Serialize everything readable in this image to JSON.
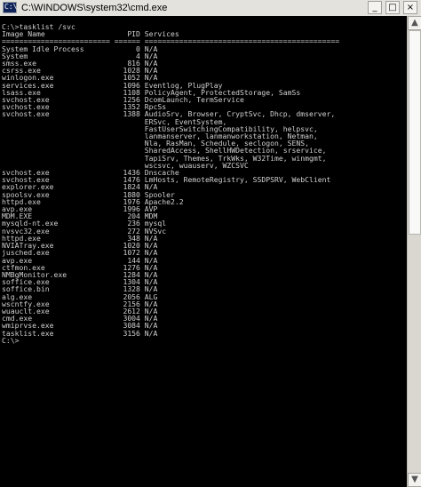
{
  "window": {
    "title": "C:\\WINDOWS\\system32\\cmd.exe",
    "icon_label": "C:\\",
    "buttons": {
      "minimize": "_",
      "maximize": "□",
      "close": "×"
    }
  },
  "scrollbar": {
    "up": "▲",
    "down": "▼"
  },
  "console": {
    "lines": [
      "C:\\>tasklist /svc",
      "",
      "Image Name                   PID Services",
      "========================= ====== =============================================",
      "System Idle Process            0 N/A",
      "System                         4 N/A",
      "smss.exe                     816 N/A",
      "csrss.exe                   1028 N/A",
      "winlogon.exe                1052 N/A",
      "services.exe                1096 Eventlog, PlugPlay",
      "lsass.exe                   1108 PolicyAgent, ProtectedStorage, SamSs",
      "svchost.exe                 1256 DcomLaunch, TermService",
      "svchost.exe                 1352 RpcSs",
      "svchost.exe                 1388 AudioSrv, Browser, CryptSvc, Dhcp, dmserver,",
      "                                 ERSvc, EventSystem,",
      "                                 FastUserSwitchingCompatibility, helpsvc,",
      "                                 lanmanserver, lanmanworkstation, Netman,",
      "                                 Nla, RasMan, Schedule, seclogon, SENS,",
      "                                 SharedAccess, ShellHWDetection, srservice,",
      "                                 TapiSrv, Themes, TrkWks, W32Time, winmgmt,",
      "                                 wscsvc, wuauserv, WZCSVC",
      "svchost.exe                 1436 Dnscache",
      "svchost.exe                 1476 LmHosts, RemoteRegistry, SSDPSRV, WebClient",
      "explorer.exe                1824 N/A",
      "spoolsv.exe                 1880 Spooler",
      "httpd.exe                   1976 Apache2.2",
      "avp.exe                     1996 AVP",
      "MDM.EXE                      204 MDM",
      "mysqld-nt.exe                236 mysql",
      "nvsvc32.exe                  272 NVSvc",
      "httpd.exe                    348 N/A",
      "NVIATray.exe                1020 N/A",
      "jusched.exe                 1072 N/A",
      "avp.exe                      144 N/A",
      "ctfmon.exe                  1276 N/A",
      "NMBgMonitor.exe             1284 N/A",
      "soffice.exe                 1304 N/A",
      "soffice.bin                 1328 N/A",
      "alg.exe                     2056 ALG",
      "wscntfy.exe                 2156 N/A",
      "wuauclt.exe                 2612 N/A",
      "cmd.exe                     3004 N/A",
      "wmiprvse.exe                3084 N/A",
      "tasklist.exe                3156 N/A",
      "",
      "C:\\>"
    ]
  }
}
